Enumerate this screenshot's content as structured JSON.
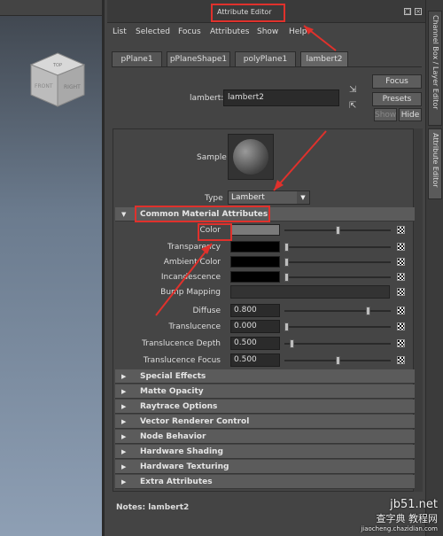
{
  "viewport": {
    "cube_faces": [
      "TOP",
      "FRONT",
      "RIGHT"
    ]
  },
  "window": {
    "title": "Attribute Editor"
  },
  "menu": [
    "List",
    "Selected",
    "Focus",
    "Attributes",
    "Show",
    "Help"
  ],
  "tabs": [
    "pPlane1",
    "pPlaneShape1",
    "polyPlane1",
    "lambert2"
  ],
  "node": {
    "label": "lambert:",
    "value": "lambert2"
  },
  "buttons": {
    "focus": "Focus",
    "presets": "Presets",
    "show": "Show",
    "hide": "Hide"
  },
  "sample": {
    "label": "Sample"
  },
  "type": {
    "label": "Type",
    "value": "Lambert"
  },
  "common": {
    "title": "Common Material Attributes",
    "rows": [
      {
        "label": "Color",
        "kind": "color",
        "color": "#7a7a7a",
        "slider": 0.5
      },
      {
        "label": "Transparency",
        "kind": "color",
        "color": "#000000",
        "slider": 0.0
      },
      {
        "label": "Ambient Color",
        "kind": "color",
        "color": "#000000",
        "slider": 0.0
      },
      {
        "label": "Incandescence",
        "kind": "color",
        "color": "#000000",
        "slider": 0.0
      },
      {
        "label": "Bump Mapping",
        "kind": "bump"
      },
      {
        "label": "Diffuse",
        "kind": "value",
        "value": "0.800",
        "slider": 0.8
      },
      {
        "label": "Translucence",
        "kind": "value",
        "value": "0.000",
        "slider": 0.0
      },
      {
        "label": "Translucence Depth",
        "kind": "value",
        "value": "0.500",
        "slider": 0.05
      },
      {
        "label": "Translucence Focus",
        "kind": "value",
        "value": "0.500",
        "slider": 0.5
      }
    ]
  },
  "sections": [
    "Special Effects",
    "Matte Opacity",
    "Raytrace Options",
    "Vector Renderer Control",
    "Node Behavior",
    "Hardware Shading",
    "Hardware Texturing",
    "Extra Attributes"
  ],
  "notes": {
    "label": "Notes:",
    "value": "lambert2"
  },
  "side_tabs": [
    "Channel Box / Layer Editor",
    "Attribute Editor"
  ],
  "watermark": {
    "line1": "jb51.net",
    "line2": "查字典 教程网",
    "line3": "jiaocheng.chazidian.com"
  },
  "colors": {
    "highlight": "#e0312c",
    "panel": "#444444",
    "section": "#5b5b5b"
  }
}
